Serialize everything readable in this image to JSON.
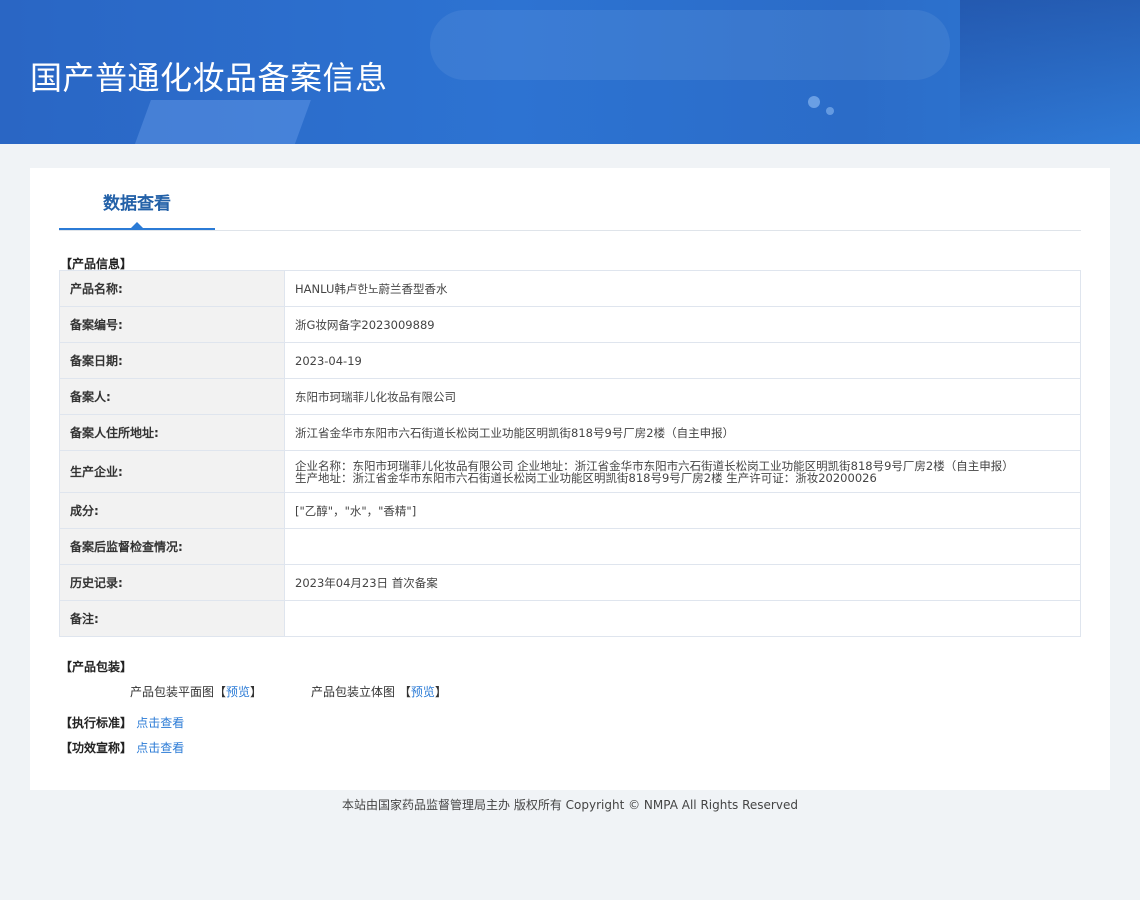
{
  "header": {
    "title": "国产普通化妆品备案信息"
  },
  "tabs": [
    {
      "label": "数据查看"
    }
  ],
  "product_info": {
    "section_label": "【产品信息】",
    "rows": [
      {
        "label": "产品名称:",
        "value": "HANLU韩卢한노蔚兰香型香水"
      },
      {
        "label": "备案编号:",
        "value": "浙G妆网备字2023009889"
      },
      {
        "label": "备案日期:",
        "value": "2023-04-19"
      },
      {
        "label": "备案人:",
        "value": "东阳市珂瑞菲儿化妆品有限公司"
      },
      {
        "label": "备案人住所地址:",
        "value": "浙江省金华市东阳市六石街道长松岗工业功能区明凯街818号9号厂房2楼（自主申报）"
      },
      {
        "label": "生产企业:",
        "value": "企业名称：东阳市珂瑞菲儿化妆品有限公司 企业地址：浙江省金华市东阳市六石街道长松岗工业功能区明凯街818号9号厂房2楼（自主申报） 生产地址：浙江省金华市东阳市六石街道长松岗工业功能区明凯街818号9号厂房2楼 生产许可证：浙妆20200026"
      },
      {
        "label": "成分:",
        "value": "[\"乙醇\"，\"水\"，\"香精\"]"
      },
      {
        "label": "备案后监督检查情况:",
        "value": ""
      },
      {
        "label": "历史记录:",
        "value": "2023年04月23日 首次备案"
      },
      {
        "label": "备注:",
        "value": ""
      }
    ]
  },
  "packaging": {
    "section_label": "【产品包装】",
    "flat_label": "产品包装平面图",
    "solid_label": "产品包装立体图",
    "bracket_open": "【",
    "bracket_close": "】",
    "preview_link": "预览"
  },
  "standard": {
    "label": "【执行标准】",
    "link": "点击查看"
  },
  "efficacy": {
    "label": "【功效宣称】",
    "link": "点击查看"
  },
  "footer": {
    "text": "本站由国家药品监督管理局主办 版权所有 Copyright © NMPA All Rights Reserved"
  }
}
